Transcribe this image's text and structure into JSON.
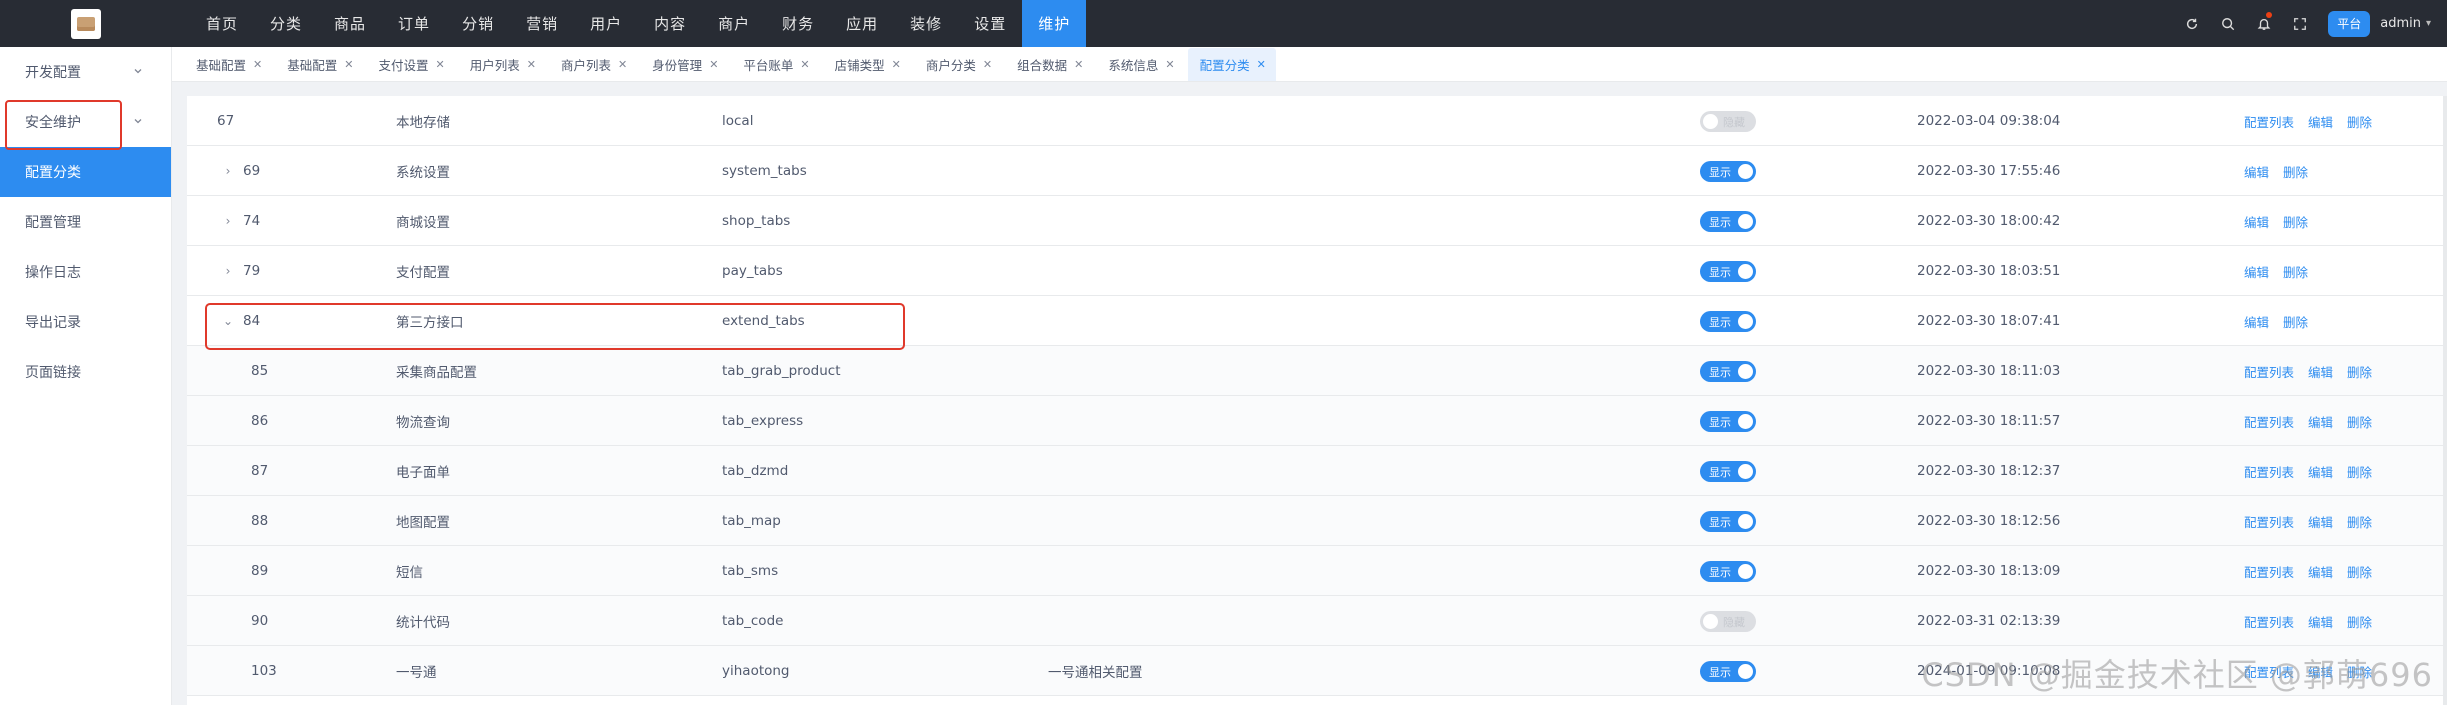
{
  "topnav": {
    "items": [
      "首页",
      "分类",
      "商品",
      "订单",
      "分销",
      "营销",
      "用户",
      "内容",
      "商户",
      "财务",
      "应用",
      "装修",
      "设置",
      "维护"
    ],
    "active_index": 13
  },
  "top_right": {
    "icons": [
      "refresh-icon",
      "search-icon",
      "bell-icon",
      "fullscreen-icon"
    ],
    "platform_label": "平台",
    "username": "admin"
  },
  "sidebar": {
    "items": [
      {
        "label": "开发配置",
        "expandable": true
      },
      {
        "label": "安全维护",
        "expandable": true
      },
      {
        "label": "配置分类",
        "expandable": false
      },
      {
        "label": "配置管理",
        "expandable": false
      },
      {
        "label": "操作日志",
        "expandable": false
      },
      {
        "label": "导出记录",
        "expandable": false
      },
      {
        "label": "页面链接",
        "expandable": false
      }
    ],
    "active_index": 2
  },
  "tabs": {
    "items": [
      "基础配置",
      "基础配置",
      "支付设置",
      "用户列表",
      "商户列表",
      "身份管理",
      "平台账单",
      "店铺类型",
      "商户分类",
      "组合数据",
      "系统信息",
      "配置分类"
    ],
    "active_index": 11
  },
  "table": {
    "rows": [
      {
        "id": "67",
        "name": "本地存储",
        "key": "local",
        "note": "",
        "status": "隐藏",
        "on": false,
        "time": "2022-03-04 09:38:04",
        "actions": [
          "配置列表",
          "编辑",
          "删除"
        ],
        "expander": "",
        "child": false
      },
      {
        "id": "69",
        "name": "系统设置",
        "key": "system_tabs",
        "note": "",
        "status": "显示",
        "on": true,
        "time": "2022-03-30 17:55:46",
        "actions": [
          "编辑",
          "删除"
        ],
        "expander": "›",
        "child": false
      },
      {
        "id": "74",
        "name": "商城设置",
        "key": "shop_tabs",
        "note": "",
        "status": "显示",
        "on": true,
        "time": "2022-03-30 18:00:42",
        "actions": [
          "编辑",
          "删除"
        ],
        "expander": "›",
        "child": false
      },
      {
        "id": "79",
        "name": "支付配置",
        "key": "pay_tabs",
        "note": "",
        "status": "显示",
        "on": true,
        "time": "2022-03-30 18:03:51",
        "actions": [
          "编辑",
          "删除"
        ],
        "expander": "›",
        "child": false
      },
      {
        "id": "84",
        "name": "第三方接口",
        "key": "extend_tabs",
        "note": "",
        "status": "显示",
        "on": true,
        "time": "2022-03-30 18:07:41",
        "actions": [
          "编辑",
          "删除"
        ],
        "expander": "⌄",
        "child": false
      },
      {
        "id": "85",
        "name": "采集商品配置",
        "key": "tab_grab_product",
        "note": "",
        "status": "显示",
        "on": true,
        "time": "2022-03-30 18:11:03",
        "actions": [
          "配置列表",
          "编辑",
          "删除"
        ],
        "expander": "",
        "child": true
      },
      {
        "id": "86",
        "name": "物流查询",
        "key": "tab_express",
        "note": "",
        "status": "显示",
        "on": true,
        "time": "2022-03-30 18:11:57",
        "actions": [
          "配置列表",
          "编辑",
          "删除"
        ],
        "expander": "",
        "child": true
      },
      {
        "id": "87",
        "name": "电子面单",
        "key": "tab_dzmd",
        "note": "",
        "status": "显示",
        "on": true,
        "time": "2022-03-30 18:12:37",
        "actions": [
          "配置列表",
          "编辑",
          "删除"
        ],
        "expander": "",
        "child": true
      },
      {
        "id": "88",
        "name": "地图配置",
        "key": "tab_map",
        "note": "",
        "status": "显示",
        "on": true,
        "time": "2022-03-30 18:12:56",
        "actions": [
          "配置列表",
          "编辑",
          "删除"
        ],
        "expander": "",
        "child": true
      },
      {
        "id": "89",
        "name": "短信",
        "key": "tab_sms",
        "note": "",
        "status": "显示",
        "on": true,
        "time": "2022-03-30 18:13:09",
        "actions": [
          "配置列表",
          "编辑",
          "删除"
        ],
        "expander": "",
        "child": true
      },
      {
        "id": "90",
        "name": "统计代码",
        "key": "tab_code",
        "note": "",
        "status": "隐藏",
        "on": false,
        "time": "2022-03-31 02:13:39",
        "actions": [
          "配置列表",
          "编辑",
          "删除"
        ],
        "expander": "",
        "child": true
      },
      {
        "id": "103",
        "name": "一号通",
        "key": "yihaotong",
        "note": "一号通相关配置",
        "status": "显示",
        "on": true,
        "time": "2024-01-09 09:10:08",
        "actions": [
          "配置列表",
          "编辑",
          "删除"
        ],
        "expander": "",
        "child": true
      }
    ]
  },
  "watermark": {
    "text": "CSDN @掘金技术社区 @郭萌696"
  }
}
